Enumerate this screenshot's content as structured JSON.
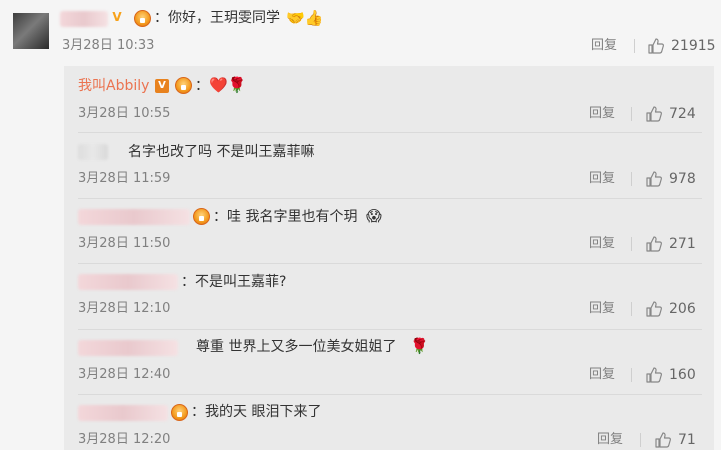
{
  "main_comment": {
    "text": "：你好，王玥雯同学",
    "emoji": "🤝👍",
    "time": "3月28日 10:33",
    "reply_label": "回复",
    "likes": "21915"
  },
  "replies": [
    {
      "name": "我叫Abbily",
      "text": "：",
      "emoji": "❤️🌹",
      "time": "3月28日 10:55",
      "reply_label": "回复",
      "likes": "724"
    },
    {
      "text": "名字也改了吗 不是叫王嘉菲嘛",
      "time": "3月28日 11:59",
      "reply_label": "回复",
      "likes": "978"
    },
    {
      "text": "：哇 我名字里也有个玥",
      "emoji": "😱",
      "time": "3月28日 11:50",
      "reply_label": "回复",
      "likes": "271"
    },
    {
      "text": "：不是叫王嘉菲?",
      "time": "3月28日 12:10",
      "reply_label": "回复",
      "likes": "206"
    },
    {
      "text": "尊重 世界上又多一位美女姐姐了",
      "emoji": "🌹",
      "time": "3月28日 12:40",
      "reply_label": "回复",
      "likes": "160"
    },
    {
      "text": "：我的天 眼泪下来了",
      "time": "3月28日 12:20",
      "reply_label": "回复",
      "likes": "71"
    }
  ]
}
